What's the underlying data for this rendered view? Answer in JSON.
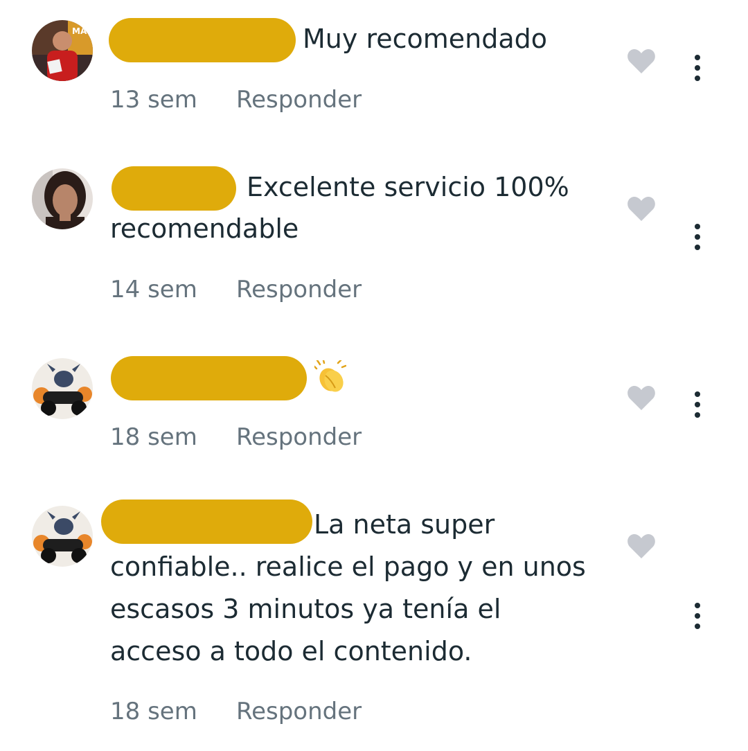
{
  "comments": [
    {
      "text_first": "Muy recomendado",
      "text_rest": [],
      "time": "13 sem",
      "reply_label": "Responder",
      "avatar": "man-red-shirt-cards",
      "like_icon": "heart-icon",
      "more_icon": "more-vertical-icon"
    },
    {
      "text_first": "Excelente servicio 100%",
      "text_rest": [
        "recomendable"
      ],
      "time": "14 sem",
      "reply_label": "Responder",
      "avatar": "woman-portrait",
      "like_icon": "heart-icon",
      "more_icon": "more-vertical-icon"
    },
    {
      "text_first": "",
      "emoji": "clapping-hands",
      "text_rest": [],
      "time": "18 sem",
      "reply_label": "Responder",
      "avatar": "stitch-motorcycle",
      "like_icon": "heart-icon",
      "more_icon": "more-vertical-icon"
    },
    {
      "text_first": "La neta super",
      "text_rest": [
        "confiable.. realice el pago y en unos",
        "escasos 3 minutos ya tenía el",
        "acceso a todo el contenido."
      ],
      "time": "18 sem",
      "reply_label": "Responder",
      "avatar": "stitch-motorcycle",
      "like_icon": "heart-icon",
      "more_icon": "more-vertical-icon"
    }
  ],
  "colors": {
    "redaction": "#dfab0b",
    "text": "#1c2b33",
    "meta": "#65737d",
    "heart": "#c6c9d0",
    "more": "#1c2b33"
  }
}
